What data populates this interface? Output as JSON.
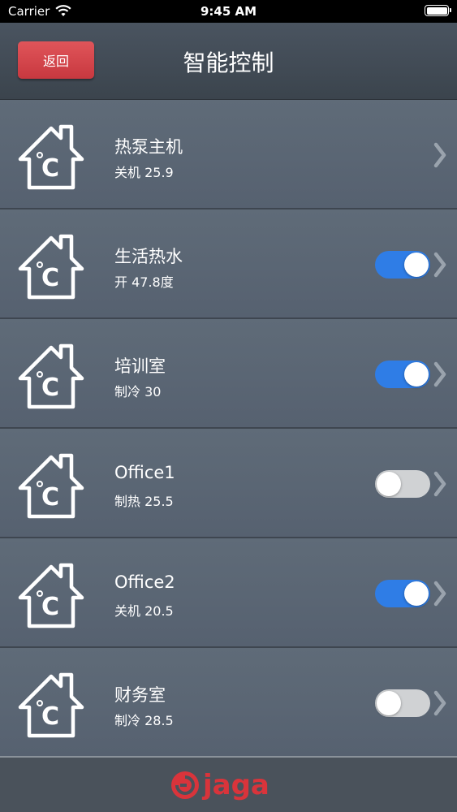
{
  "status_bar": {
    "carrier": "Carrier",
    "time": "9:45 AM"
  },
  "nav": {
    "back_label": "返回",
    "title": "智能控制"
  },
  "items": [
    {
      "name": "热泵主机",
      "status": "关机 25.9",
      "has_toggle": false,
      "toggle_on": false
    },
    {
      "name": "生活热水",
      "status": "开 47.8度",
      "has_toggle": true,
      "toggle_on": true
    },
    {
      "name": "培训室",
      "status": "制冷 30",
      "has_toggle": true,
      "toggle_on": true
    },
    {
      "name": "Office1",
      "status": "制热 25.5",
      "has_toggle": true,
      "toggle_on": false
    },
    {
      "name": "Office2",
      "status": "关机 20.5",
      "has_toggle": true,
      "toggle_on": true
    },
    {
      "name": "财务室",
      "status": "制冷 28.5",
      "has_toggle": true,
      "toggle_on": false
    }
  ],
  "footer": {
    "brand": "jaga"
  },
  "colors": {
    "accent": "#2f7de6",
    "back_button": "#d6474d",
    "brand": "#d9343b"
  },
  "icons": [
    "wifi-icon",
    "battery-icon",
    "house-celsius-icon",
    "chevron-right-icon"
  ]
}
